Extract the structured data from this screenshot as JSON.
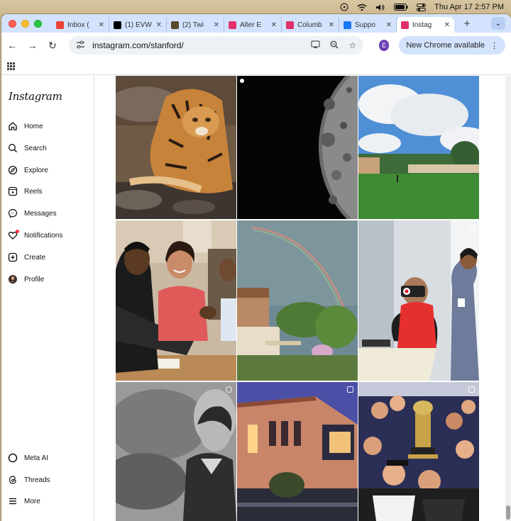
{
  "menubar": {
    "datetime": "Thu Apr 17  2:57 PM",
    "icons": [
      "play-circle-icon",
      "wifi-icon",
      "volume-icon",
      "battery-icon",
      "control-center-icon"
    ]
  },
  "browser": {
    "tabs": [
      {
        "label": "Inbox (",
        "icon": "gmail-icon",
        "color": "#ea4335"
      },
      {
        "label": "(1) EVW",
        "icon": "x-icon",
        "color": "#000000"
      },
      {
        "label": "(2) Twi",
        "icon": "site-icon",
        "color": "#5a4a2e"
      },
      {
        "label": "Alter E",
        "icon": "instagram-icon",
        "color": "#e1306c"
      },
      {
        "label": "Columb",
        "icon": "instagram-icon",
        "color": "#e1306c"
      },
      {
        "label": "Suppo",
        "icon": "meta-icon",
        "color": "#1877f2"
      },
      {
        "label": "Instag",
        "icon": "instagram-icon",
        "color": "#e1306c",
        "active": true
      }
    ],
    "url": "instagram.com/stanford/",
    "profile_initial": "E",
    "update_label": "New Chrome available"
  },
  "sidebar": {
    "logo": "Instagram",
    "items": [
      {
        "label": "Home",
        "icon": "home-icon"
      },
      {
        "label": "Search",
        "icon": "search-icon"
      },
      {
        "label": "Explore",
        "icon": "compass-icon"
      },
      {
        "label": "Reels",
        "icon": "reels-icon"
      },
      {
        "label": "Messages",
        "icon": "messenger-icon"
      },
      {
        "label": "Notifications",
        "icon": "heart-icon"
      },
      {
        "label": "Create",
        "icon": "plus-square-icon"
      },
      {
        "label": "Profile",
        "icon": "avatar-icon"
      }
    ],
    "bottom_items": [
      {
        "label": "Meta AI",
        "icon": "meta-ai-icon"
      },
      {
        "label": "Threads",
        "icon": "threads-icon"
      },
      {
        "label": "More",
        "icon": "menu-icon"
      }
    ]
  },
  "posts": [
    {
      "subject": "tiger",
      "kind": "image"
    },
    {
      "subject": "moon",
      "kind": "reel"
    },
    {
      "subject": "field",
      "kind": "image"
    },
    {
      "subject": "students",
      "kind": "image"
    },
    {
      "subject": "rainbow",
      "kind": "image"
    },
    {
      "subject": "vr-headset",
      "kind": "carousel"
    },
    {
      "subject": "portrait",
      "kind": "reel"
    },
    {
      "subject": "building",
      "kind": "carousel"
    },
    {
      "subject": "champions",
      "kind": "carousel"
    }
  ],
  "colors": {
    "tab_strip": "#d3e3fd",
    "omnibox": "#eef1f6",
    "notification_dot": "#ff3040"
  }
}
